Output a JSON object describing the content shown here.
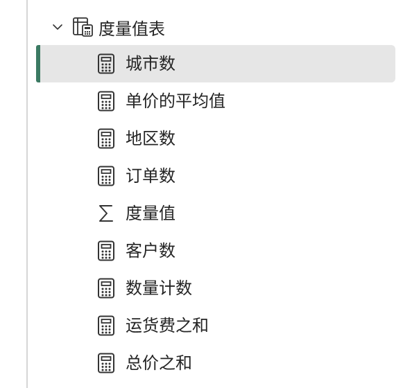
{
  "table": {
    "name": "度量值表",
    "expanded_icon": "chevron-down-icon",
    "icon": "table-calculator-icon"
  },
  "items": [
    {
      "label": "城市数",
      "icon": "calculator-icon",
      "selected": true
    },
    {
      "label": "单价的平均值",
      "icon": "calculator-icon",
      "selected": false
    },
    {
      "label": "地区数",
      "icon": "calculator-icon",
      "selected": false
    },
    {
      "label": "订单数",
      "icon": "calculator-icon",
      "selected": false
    },
    {
      "label": "度量值",
      "icon": "sigma-icon",
      "selected": false
    },
    {
      "label": "客户数",
      "icon": "calculator-icon",
      "selected": false
    },
    {
      "label": "数量计数",
      "icon": "calculator-icon",
      "selected": false
    },
    {
      "label": "运货费之和",
      "icon": "calculator-icon",
      "selected": false
    },
    {
      "label": "总价之和",
      "icon": "calculator-icon",
      "selected": false
    }
  ],
  "colors": {
    "selected_bg": "#e6e6e6",
    "accent": "#3b7a63",
    "text": "#242424",
    "border": "#d6d6d6"
  }
}
